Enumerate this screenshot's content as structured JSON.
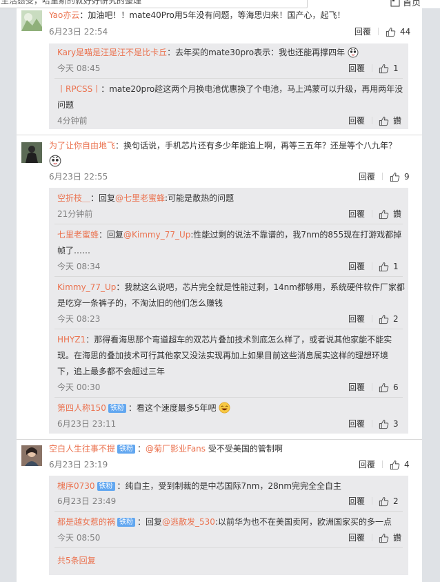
{
  "header": {
    "search_text": "生活感受，哈里斯的就好好研究的整理",
    "home_icon": "home-icon",
    "home_label": "首页"
  },
  "common": {
    "reply_label": "回覆",
    "like_icon": "thumbs-up-icon",
    "zero_like_label": "讚",
    "fan_badge": "铁粉",
    "more_replies": "共5条回复"
  },
  "comments": [
    {
      "user": "Yao亦云",
      "text": "：加油吧！！mate40Pro用5年没有问题，等海思归来！国产心，起飞！",
      "time": "6月23日 22:54",
      "likes": "44",
      "replies": [
        {
          "user": "Kary是喵是汪是汪不是比卡丘",
          "text": "：去年买的mate30pro表示：我也还能再撑四年",
          "time": "今天 08:45",
          "likes": "1"
        },
        {
          "user": "丨RPCSS丨",
          "text_line1": "：mate20pro趁这两个月换电池优惠换了个电池，马上鸿蒙可以升级，再用两年没",
          "text_line2": "问题",
          "time": "4分钟前",
          "likes": "讚"
        }
      ]
    },
    {
      "user": "为了让你自由地飞",
      "text": "：换句话说，手机芯片还有多少年能追上啊，再等三五年？还是等个八九年？",
      "time": "6月23日 22:55",
      "likes": "9",
      "replies": [
        {
          "user": "空折枝＿",
          "prefix": "：回复",
          "mention": "@七里老蜜蜂",
          "text": ":可能是散热的问题",
          "time": "21分钟前",
          "likes": "讚"
        },
        {
          "user": "七里老蜜蜂",
          "prefix": "：回复",
          "mention": "@Kimmy_77_Up",
          "text_line1": ":性能过剩的说法不靠谱的，我7nm的855现在打游戏都掉",
          "text_line2": "帧了……",
          "time": "今天 08:34",
          "likes": "1"
        },
        {
          "user": "Kimmy_77_Up",
          "text_line1": "：我就这么说吧，芯片完全就是性能过剩，14nm都够用，系统硬件软件厂家都",
          "text_line2": "是吃穿一条裤子的，不淘汰旧的他们怎么赚钱",
          "time": "今天 08:23",
          "likes": "2"
        },
        {
          "user": "HHYZ1",
          "text_line1": "：那得看海思那个弯道超车的双芯片叠加技术到底怎么样了，或者说其他家能不能实",
          "text_line2": "现。在海思的叠加技术可行其他家又没法实现再加上如果目前这些消息属实这样的理想环境",
          "text_line3": "下，追上最多都不会超过三年",
          "time": "今天 00:30",
          "likes": "6"
        },
        {
          "user": "第四人称150",
          "text": "：看这个速度最多5年吧",
          "time": "6月23日 23:11",
          "likes": "3"
        }
      ]
    },
    {
      "user": "空白人生往事不提",
      "text_prefix": "：",
      "mention": "@菊厂影业Fans",
      "text": " 受不受美国的管制啊",
      "time": "6月23日 23:19",
      "likes": "4",
      "replies": [
        {
          "user": "槐序0730",
          "text": "：纯自主，受到制裁的是中芯国际7nm，28nm完完全全自主",
          "time": "6月23日 23:49",
          "likes": "2"
        },
        {
          "user": "都是越女惹的祸",
          "prefix": "：回复",
          "mention": "@逃散发_530",
          "text": ":以前华为也不在美国卖阿，欧洲国家买的多一点",
          "time": "今天 08:50",
          "likes": "讚"
        }
      ]
    }
  ]
}
